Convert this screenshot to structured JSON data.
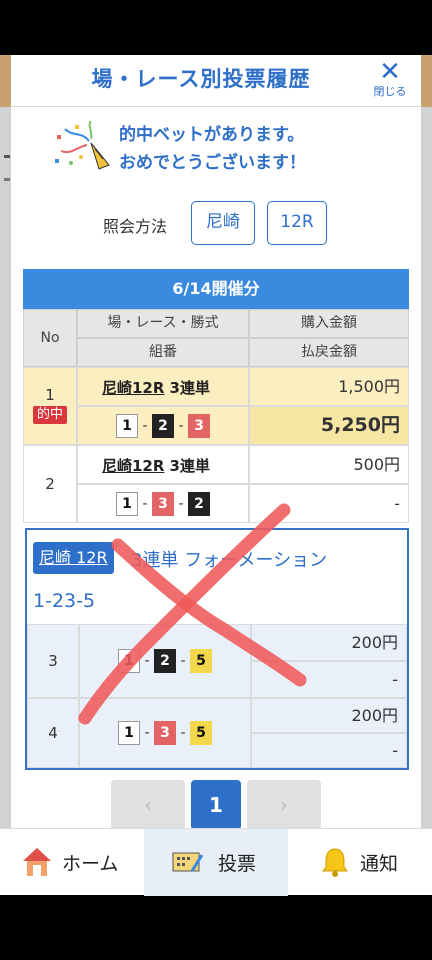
{
  "modal": {
    "title": "場・レース別投票履歴",
    "close_label": "閉じる",
    "congrats_line1": "的中ベットがあります。",
    "congrats_line2": "おめでとうございます！",
    "inquiry_label": "照会方法",
    "venue_chip": "尼崎",
    "race_chip": "12R"
  },
  "table": {
    "date_title": "6/14開催分",
    "headers": {
      "no": "No",
      "race_type": "場・レース・勝式",
      "combo": "組番",
      "purchase": "購入金額",
      "payout": "払戻金額"
    },
    "rows": [
      {
        "no": "1",
        "hit_badge": "的中",
        "race": "尼崎12R",
        "bet_type": "3連単",
        "combo": [
          "1",
          "2",
          "3"
        ],
        "purchase": "1,500円",
        "payout": "5,250円"
      },
      {
        "no": "2",
        "race": "尼崎12R",
        "bet_type": "3連単",
        "combo": [
          "1",
          "3",
          "2"
        ],
        "purchase": "500円",
        "payout": "-"
      }
    ],
    "formation": {
      "venue_race": "尼崎 12R",
      "type": "3連単 フォーメーション",
      "combo": "1-23-5",
      "rows": [
        {
          "no": "3",
          "combo": [
            "1",
            "2",
            "5"
          ],
          "purchase": "200円",
          "payout": "-"
        },
        {
          "no": "4",
          "combo": [
            "1",
            "3",
            "5"
          ],
          "purchase": "200円",
          "payout": "-"
        }
      ]
    }
  },
  "pager": {
    "prev": "‹",
    "current": "1",
    "next": "›"
  },
  "tabs": [
    {
      "label": "ホーム",
      "icon": "home-icon"
    },
    {
      "label": "投票",
      "icon": "ticket-icon"
    },
    {
      "label": "通知",
      "icon": "bell-icon"
    }
  ],
  "colors": {
    "accent": "#2e6fc9",
    "table_header": "#3a8ae0",
    "hit_badge": "#d9363e",
    "hit_row": "#fbeec0",
    "scribble": "#ef5a5a"
  }
}
